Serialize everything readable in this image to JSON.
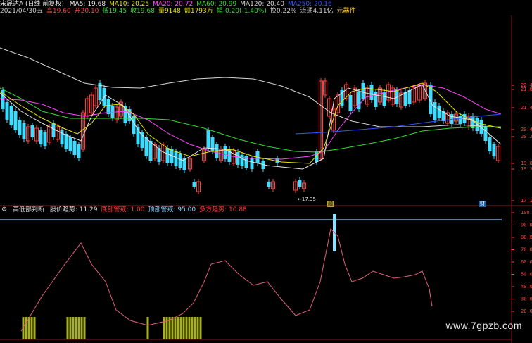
{
  "colors": {
    "bg": "#000000",
    "up": "#ff3b3b",
    "down": "#3fdcff",
    "ma5": "#e8e8e8",
    "ma10": "#e6e600",
    "ma20": "#ff44ff",
    "ma60": "#33dd33",
    "ma120": "#d8d8d8",
    "ma250": "#3355ff",
    "indicator_line": "#e0607a",
    "bar_up": "#a7b020",
    "bar_extreme": "#8fe0ff",
    "hline": "#7fd4ff",
    "grid": "#8a1a1a",
    "axis_text": "#ff4040"
  },
  "header": {
    "name": "宋晟达A (日线 前复权)",
    "ma": [
      {
        "label": "MA5: 19.68",
        "color": "#e8e8e8"
      },
      {
        "label": "MA10: 20.25",
        "color": "#e6e600"
      },
      {
        "label": "MA20: 20.72",
        "color": "#ff44ff"
      },
      {
        "label": "MA60: 20.99",
        "color": "#33dd33"
      },
      {
        "label": "MA120: 20.40",
        "color": "#d8d8d8"
      },
      {
        "label": "MA250: 20.16",
        "color": "#3355ff"
      }
    ],
    "quote": [
      {
        "label": "2021/04/30五",
        "color": "#cccccc"
      },
      {
        "label": "高19.60",
        "color": "#ff4040"
      },
      {
        "label": "开20.10",
        "color": "#ff4040"
      },
      {
        "label": "低19.45",
        "color": "#33dd33"
      },
      {
        "label": "收19.68",
        "color": "#33dd33"
      },
      {
        "label": "量9148",
        "color": "#e6e600"
      },
      {
        "label": "额1793万",
        "color": "#e6e600"
      },
      {
        "label": "幅-0.20(-1.40%)",
        "color": "#33dd33"
      },
      {
        "label": "换0.22%",
        "color": "#cccccc"
      },
      {
        "label": "流通4.11亿",
        "color": "#cccccc"
      },
      {
        "label": "元器件",
        "color": "#ffcc33"
      }
    ]
  },
  "price_axis": {
    "labels": [
      "22.40",
      "21.89",
      "21.40",
      "20.40",
      "20.2",
      "19.60",
      "19.1",
      "17.13"
    ]
  },
  "annotations": {
    "low_marker": "←17.35",
    "badge1": "融",
    "badge2": "财"
  },
  "indicator": {
    "title": "高低部判断",
    "items": [
      {
        "label": "股价趋势: 11.29",
        "color": "#e0e0e0"
      },
      {
        "label": "底部警戒: 1.00",
        "color": "#ff4040"
      },
      {
        "label": "顶部警戒: 95.00",
        "color": "#7fd4ff"
      },
      {
        "label": "多方趋势: 10.88",
        "color": "#ff4040"
      }
    ],
    "axis_labels": [
      "100.00",
      "90.00",
      "80.00",
      "70.00",
      "60.00",
      "50.00",
      "40.00",
      "30.00",
      "20.00"
    ]
  },
  "watermark": "www.7gpzb.com"
}
